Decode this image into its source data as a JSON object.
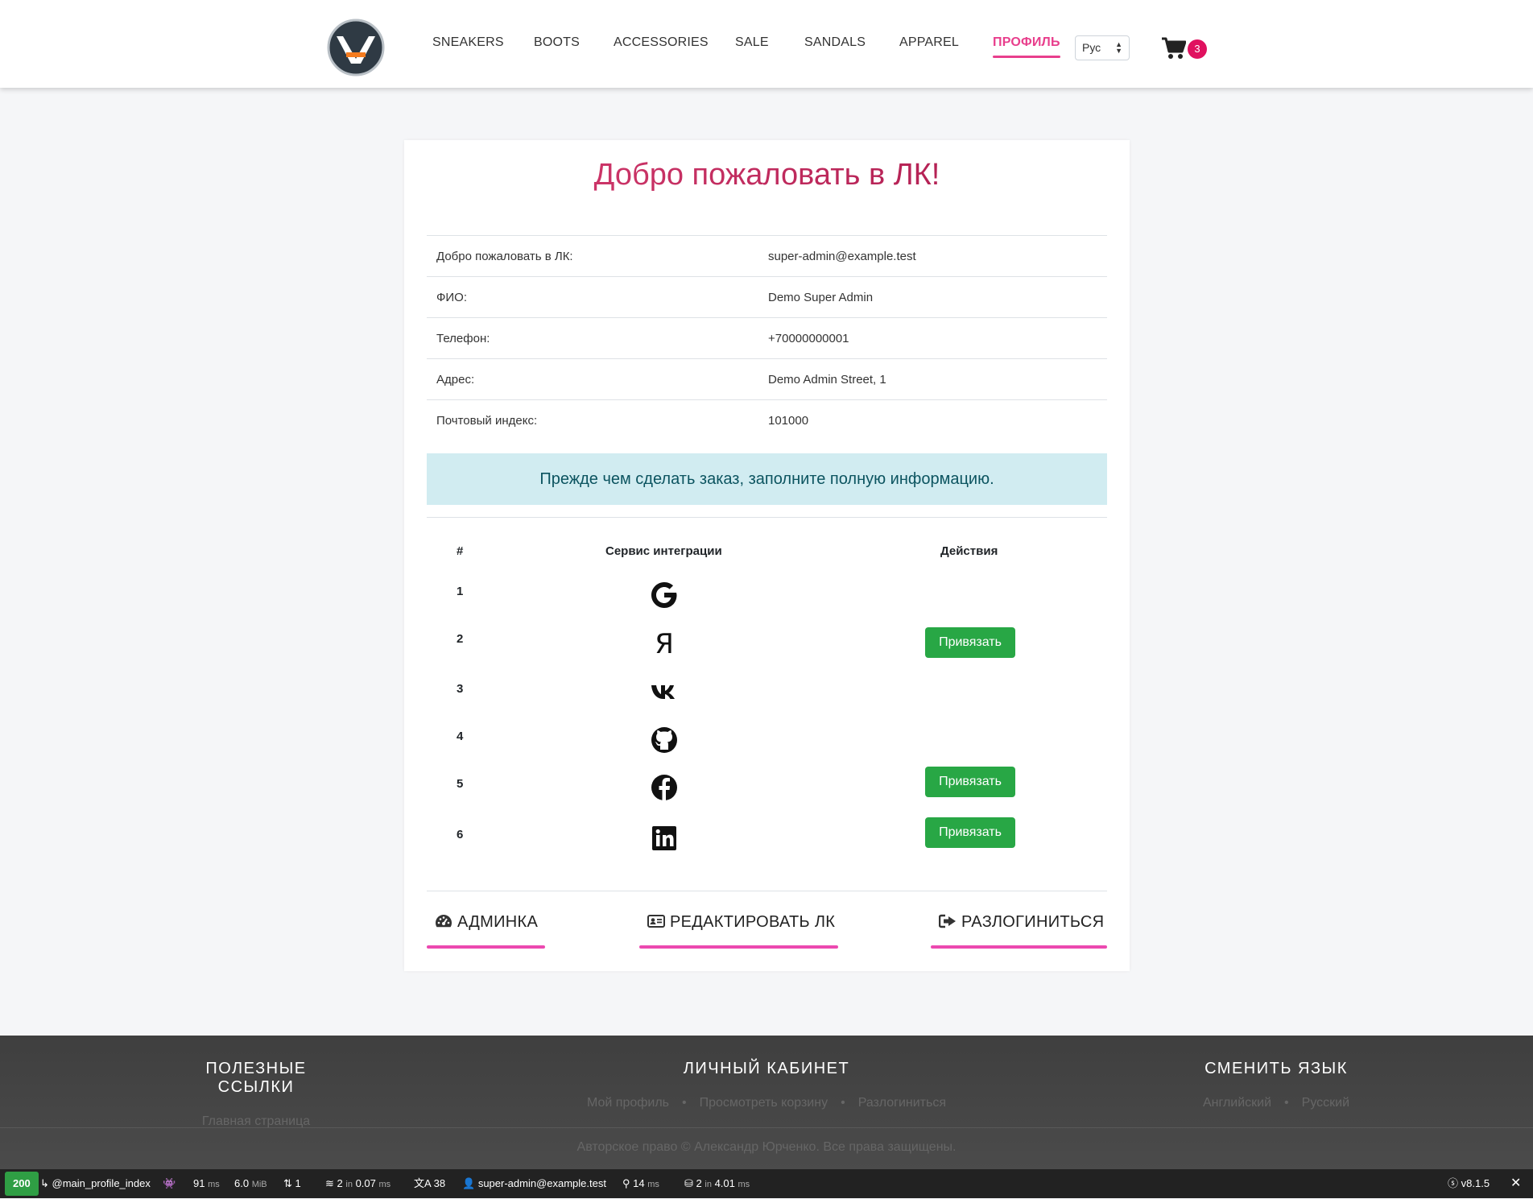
{
  "header": {
    "nav": [
      {
        "label": "SNEAKERS"
      },
      {
        "label": "BOOTS"
      },
      {
        "label": "ACCESSORIES"
      },
      {
        "label": "SALE"
      },
      {
        "label": "SANDALS"
      },
      {
        "label": "APPAREL"
      },
      {
        "label": "ПРОФИЛЬ",
        "active": true
      }
    ],
    "language": "Рус",
    "cart_count": "3"
  },
  "profile": {
    "title": "Добро пожаловать в ЛК!",
    "rows": [
      {
        "label": "Добро пожаловать в ЛК:",
        "value": "super-admin@example.test"
      },
      {
        "label": "ФИО:",
        "value": "Demo Super Admin"
      },
      {
        "label": "Телефон:",
        "value": "+70000000001"
      },
      {
        "label": "Адрес:",
        "value": "Demo Admin Street, 1"
      },
      {
        "label": "Почтовый индекс:",
        "value": "101000"
      }
    ],
    "alert": "Прежде чем сделать заказ, заполните полную информацию."
  },
  "integrations": {
    "headers": {
      "num": "#",
      "service": "Сервис интеграции",
      "actions": "Действия"
    },
    "rows": [
      {
        "num": "1",
        "icon": "google-icon",
        "button": ""
      },
      {
        "num": "2",
        "icon": "yandex-icon",
        "button": "Привязать"
      },
      {
        "num": "3",
        "icon": "vk-icon",
        "button": ""
      },
      {
        "num": "4",
        "icon": "github-icon",
        "button": ""
      },
      {
        "num": "5",
        "icon": "facebook-icon",
        "button": "Привязать"
      },
      {
        "num": "6",
        "icon": "linkedin-icon",
        "button": "Привязать"
      }
    ]
  },
  "actions": {
    "admin": "АДМИНКА",
    "edit": "РЕДАКТИРОВАТЬ ЛК",
    "logout": "РАЗЛОГИНИТЬСЯ"
  },
  "footer": {
    "useful": {
      "title": "ПОЛЕЗНЫЕ ССЫЛКИ",
      "links": [
        "Главная страница"
      ]
    },
    "account": {
      "title": "ЛИЧНЫЙ КАБИНЕТ",
      "links": [
        "Мой профиль",
        "Просмотреть корзину",
        "Разлогиниться"
      ]
    },
    "language": {
      "title": "СМЕНИТЬ ЯЗЫК",
      "links": [
        "Английский",
        "Русский"
      ]
    },
    "copyright": "Авторское право © Александр Юрченко. Все права защищены."
  },
  "toolbar": {
    "status": "200",
    "route": "@main_profile_index",
    "time_value": "91",
    "time_unit": "ms",
    "memory_value": "6.0",
    "memory_unit": "MiB",
    "requests": "1",
    "templates_prefix": "2",
    "templates_in": "in",
    "templates_value": "0.07",
    "templates_unit": "ms",
    "translations": "38",
    "user": "super-admin@example.test",
    "cache_value": "14",
    "cache_unit": "ms",
    "db_prefix": "2",
    "db_in": "in",
    "db_value": "4.01",
    "db_unit": "ms",
    "version": "v8.1.5",
    "colors": {
      "ok": "#2f9e44"
    }
  },
  "colors": {
    "accent": "#e83e8c",
    "button": "#28a745",
    "alert_bg": "#d1ecf1"
  }
}
